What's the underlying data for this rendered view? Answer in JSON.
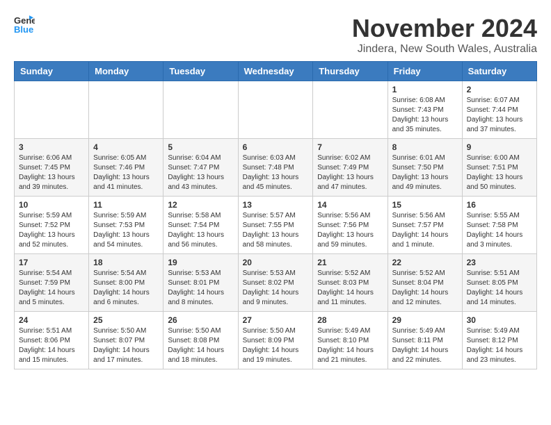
{
  "header": {
    "logo_general": "General",
    "logo_blue": "Blue",
    "title": "November 2024",
    "subtitle": "Jindera, New South Wales, Australia"
  },
  "columns": [
    "Sunday",
    "Monday",
    "Tuesday",
    "Wednesday",
    "Thursday",
    "Friday",
    "Saturday"
  ],
  "weeks": [
    [
      {
        "day": "",
        "info": ""
      },
      {
        "day": "",
        "info": ""
      },
      {
        "day": "",
        "info": ""
      },
      {
        "day": "",
        "info": ""
      },
      {
        "day": "",
        "info": ""
      },
      {
        "day": "1",
        "info": "Sunrise: 6:08 AM\nSunset: 7:43 PM\nDaylight: 13 hours and 35 minutes."
      },
      {
        "day": "2",
        "info": "Sunrise: 6:07 AM\nSunset: 7:44 PM\nDaylight: 13 hours and 37 minutes."
      }
    ],
    [
      {
        "day": "3",
        "info": "Sunrise: 6:06 AM\nSunset: 7:45 PM\nDaylight: 13 hours and 39 minutes."
      },
      {
        "day": "4",
        "info": "Sunrise: 6:05 AM\nSunset: 7:46 PM\nDaylight: 13 hours and 41 minutes."
      },
      {
        "day": "5",
        "info": "Sunrise: 6:04 AM\nSunset: 7:47 PM\nDaylight: 13 hours and 43 minutes."
      },
      {
        "day": "6",
        "info": "Sunrise: 6:03 AM\nSunset: 7:48 PM\nDaylight: 13 hours and 45 minutes."
      },
      {
        "day": "7",
        "info": "Sunrise: 6:02 AM\nSunset: 7:49 PM\nDaylight: 13 hours and 47 minutes."
      },
      {
        "day": "8",
        "info": "Sunrise: 6:01 AM\nSunset: 7:50 PM\nDaylight: 13 hours and 49 minutes."
      },
      {
        "day": "9",
        "info": "Sunrise: 6:00 AM\nSunset: 7:51 PM\nDaylight: 13 hours and 50 minutes."
      }
    ],
    [
      {
        "day": "10",
        "info": "Sunrise: 5:59 AM\nSunset: 7:52 PM\nDaylight: 13 hours and 52 minutes."
      },
      {
        "day": "11",
        "info": "Sunrise: 5:59 AM\nSunset: 7:53 PM\nDaylight: 13 hours and 54 minutes."
      },
      {
        "day": "12",
        "info": "Sunrise: 5:58 AM\nSunset: 7:54 PM\nDaylight: 13 hours and 56 minutes."
      },
      {
        "day": "13",
        "info": "Sunrise: 5:57 AM\nSunset: 7:55 PM\nDaylight: 13 hours and 58 minutes."
      },
      {
        "day": "14",
        "info": "Sunrise: 5:56 AM\nSunset: 7:56 PM\nDaylight: 13 hours and 59 minutes."
      },
      {
        "day": "15",
        "info": "Sunrise: 5:56 AM\nSunset: 7:57 PM\nDaylight: 14 hours and 1 minute."
      },
      {
        "day": "16",
        "info": "Sunrise: 5:55 AM\nSunset: 7:58 PM\nDaylight: 14 hours and 3 minutes."
      }
    ],
    [
      {
        "day": "17",
        "info": "Sunrise: 5:54 AM\nSunset: 7:59 PM\nDaylight: 14 hours and 5 minutes."
      },
      {
        "day": "18",
        "info": "Sunrise: 5:54 AM\nSunset: 8:00 PM\nDaylight: 14 hours and 6 minutes."
      },
      {
        "day": "19",
        "info": "Sunrise: 5:53 AM\nSunset: 8:01 PM\nDaylight: 14 hours and 8 minutes."
      },
      {
        "day": "20",
        "info": "Sunrise: 5:53 AM\nSunset: 8:02 PM\nDaylight: 14 hours and 9 minutes."
      },
      {
        "day": "21",
        "info": "Sunrise: 5:52 AM\nSunset: 8:03 PM\nDaylight: 14 hours and 11 minutes."
      },
      {
        "day": "22",
        "info": "Sunrise: 5:52 AM\nSunset: 8:04 PM\nDaylight: 14 hours and 12 minutes."
      },
      {
        "day": "23",
        "info": "Sunrise: 5:51 AM\nSunset: 8:05 PM\nDaylight: 14 hours and 14 minutes."
      }
    ],
    [
      {
        "day": "24",
        "info": "Sunrise: 5:51 AM\nSunset: 8:06 PM\nDaylight: 14 hours and 15 minutes."
      },
      {
        "day": "25",
        "info": "Sunrise: 5:50 AM\nSunset: 8:07 PM\nDaylight: 14 hours and 17 minutes."
      },
      {
        "day": "26",
        "info": "Sunrise: 5:50 AM\nSunset: 8:08 PM\nDaylight: 14 hours and 18 minutes."
      },
      {
        "day": "27",
        "info": "Sunrise: 5:50 AM\nSunset: 8:09 PM\nDaylight: 14 hours and 19 minutes."
      },
      {
        "day": "28",
        "info": "Sunrise: 5:49 AM\nSunset: 8:10 PM\nDaylight: 14 hours and 21 minutes."
      },
      {
        "day": "29",
        "info": "Sunrise: 5:49 AM\nSunset: 8:11 PM\nDaylight: 14 hours and 22 minutes."
      },
      {
        "day": "30",
        "info": "Sunrise: 5:49 AM\nSunset: 8:12 PM\nDaylight: 14 hours and 23 minutes."
      }
    ]
  ]
}
